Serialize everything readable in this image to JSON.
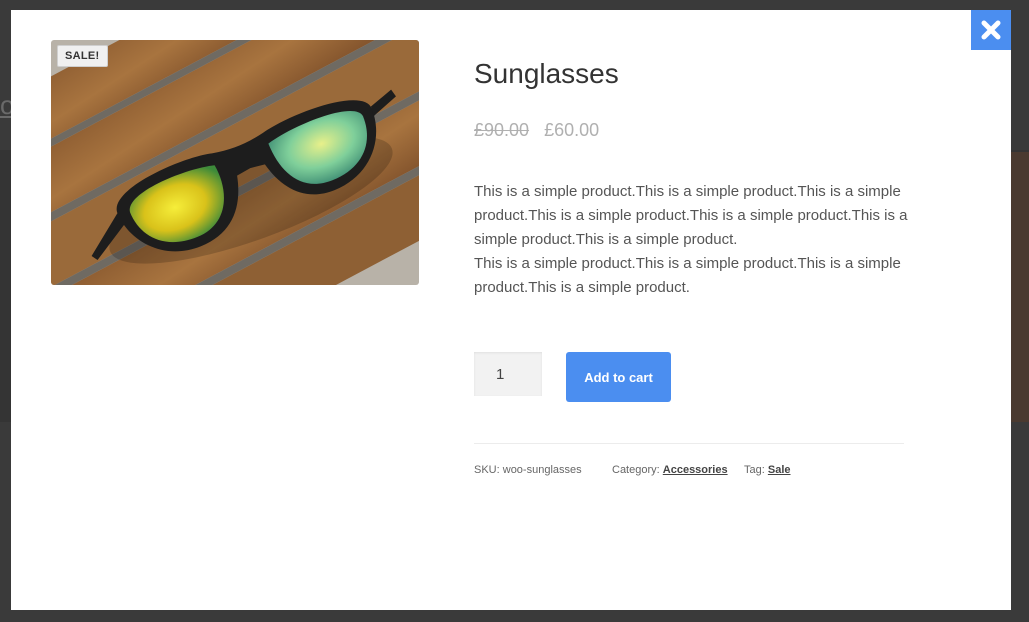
{
  "background": {
    "fragment_text": "o"
  },
  "modal": {
    "close_icon": "close-x-icon",
    "accent_color": "#4b8ef0",
    "badge": "SALE!",
    "product": {
      "title": "Sunglasses",
      "price_old": "£90.00",
      "price_new": "£60.00",
      "description_lines": [
        "This is a simple product.This is a simple product.This is a simple product.This is a simple product.This is a simple product.This is a simple product.This is a simple product.",
        "This is a simple product.This is a simple product.This is a simple product.This is a simple product."
      ],
      "quantity": "1",
      "add_to_cart_label": "Add to cart",
      "meta": {
        "sku_label": "SKU:",
        "sku_value": "woo-sunglasses",
        "category_label": "Category:",
        "category_value": "Accessories",
        "tag_label": "Tag:",
        "tag_value": "Sale"
      }
    }
  }
}
